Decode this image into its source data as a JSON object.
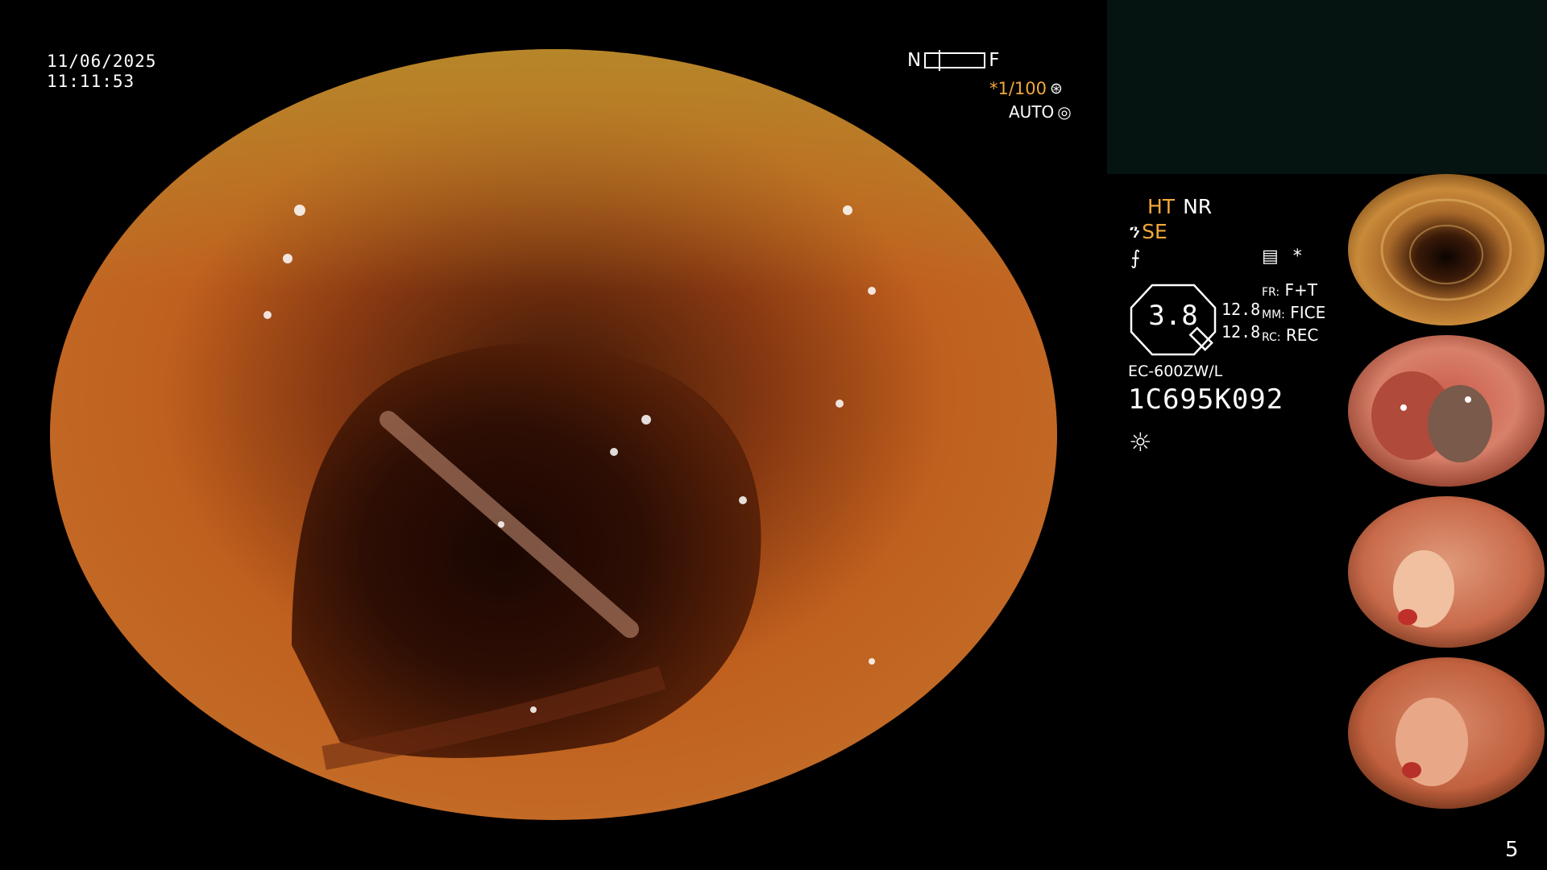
{
  "screen": {
    "date": "11/06/2025",
    "time": "11:11:53",
    "nf_near": "N",
    "nf_far": "F",
    "shutter": "*1/100",
    "shutter_icon": "aperture-icon",
    "iris_mode": "AUTO",
    "iris_icon": "iris-icon",
    "ht": "HT",
    "nr": "NR",
    "se_icon": "scope-enhance-icon",
    "se": "SE",
    "f_icon": "freeze-icon",
    "record_icon": "memory-icon",
    "asterisk": "*",
    "zoom": "3.8",
    "value_top": "12.8",
    "value_bottom": "12.8",
    "modes": [
      {
        "label": "FR:",
        "value": "F+T"
      },
      {
        "label": "MM:",
        "value": "FICE"
      },
      {
        "label": "RC:",
        "value": "REC"
      }
    ],
    "scope_model": "EC-600ZW/L",
    "scope_serial": "1C695K092",
    "light_icon": "sun-icon",
    "page_number": "5"
  },
  "colors": {
    "accent_orange": "#f2a83a",
    "panel_dark": "#051410"
  },
  "thumbnails": [
    {
      "name": "thumbnail-1"
    },
    {
      "name": "thumbnail-2"
    },
    {
      "name": "thumbnail-3"
    },
    {
      "name": "thumbnail-4"
    }
  ]
}
